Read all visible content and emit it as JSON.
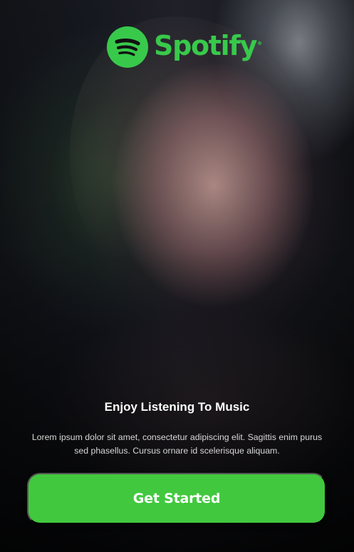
{
  "brand": {
    "name": "Spotify",
    "trademark": "®",
    "logo_icon": "spotify-logo-icon",
    "accent_color": "#38c94b"
  },
  "onboarding": {
    "title": "Enjoy Listening To Music",
    "description": "Lorem ipsum dolor sit amet, consectetur adipiscing elit. Sagittis enim purus sed phasellus. Cursus ornare id scelerisque aliquam."
  },
  "actions": {
    "primary_label": "Get Started",
    "button_color": "#42c83f"
  }
}
